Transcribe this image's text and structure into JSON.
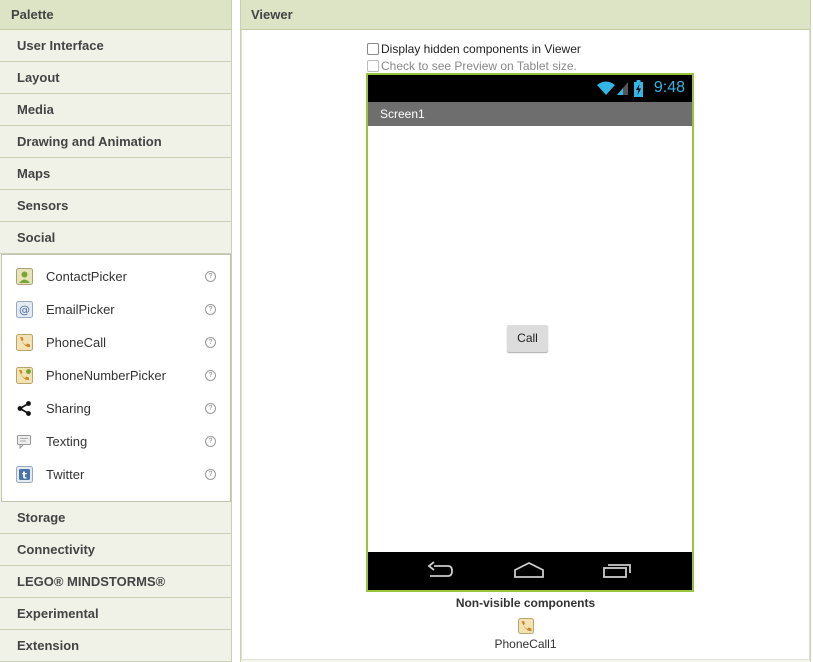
{
  "palette": {
    "title": "Palette",
    "categories_top": [
      "User Interface",
      "Layout",
      "Media",
      "Drawing and Animation",
      "Maps",
      "Sensors",
      "Social"
    ],
    "social_items": [
      {
        "label": "ContactPicker",
        "icon": "contact-icon"
      },
      {
        "label": "EmailPicker",
        "icon": "email-icon"
      },
      {
        "label": "PhoneCall",
        "icon": "phone-icon"
      },
      {
        "label": "PhoneNumberPicker",
        "icon": "phone-number-icon"
      },
      {
        "label": "Sharing",
        "icon": "share-icon"
      },
      {
        "label": "Texting",
        "icon": "texting-icon"
      },
      {
        "label": "Twitter",
        "icon": "twitter-icon"
      }
    ],
    "help": "?",
    "categories_bottom": [
      "Storage",
      "Connectivity",
      "LEGO® MINDSTORMS®",
      "Experimental",
      "Extension"
    ]
  },
  "viewer": {
    "title": "Viewer",
    "hidden_components_label": "Display hidden components in Viewer",
    "tablet_preview_label": "Check to see Preview on Tablet size.",
    "phone": {
      "time": "9:48",
      "screen_title": "Screen1",
      "button_label": "Call"
    },
    "nonvisible_label": "Non-visible components",
    "nonvisible_item": "PhoneCall1"
  },
  "colors": {
    "accent_green": "#9ac23c",
    "status_blue": "#33b5e5"
  }
}
